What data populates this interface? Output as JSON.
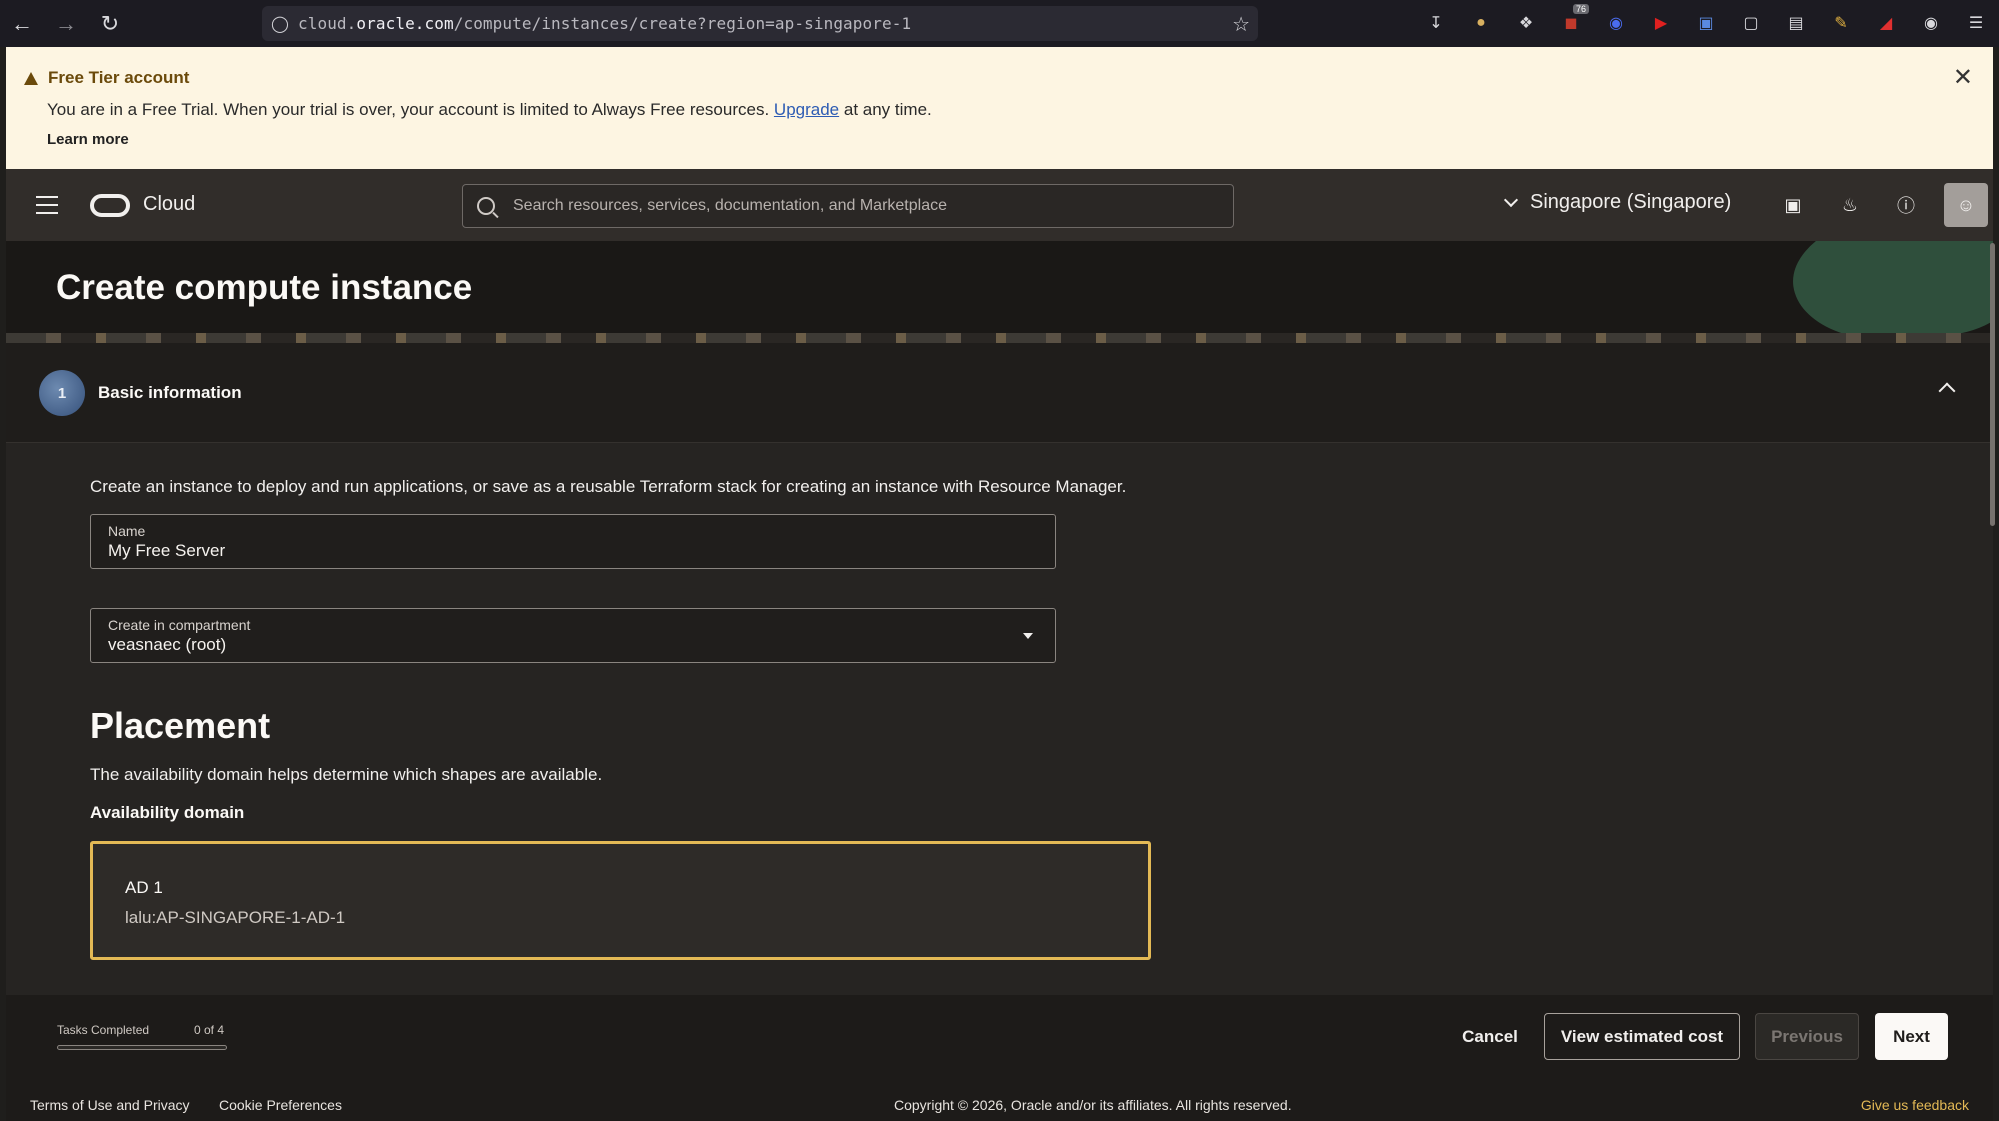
{
  "browser": {
    "url_prefix": "cloud.",
    "url_domain": "oracle.com",
    "url_path": "/compute/instances/create?region=ap-singapore-1",
    "ext_badge": "76"
  },
  "banner": {
    "title": "Free Tier account",
    "text_before": "You are in a Free Trial. When your trial is over, your account is limited to Always Free resources.",
    "link": "Upgrade",
    "text_after": "at any time.",
    "learn_more": "Learn more"
  },
  "header": {
    "brand": "Cloud",
    "search_placeholder": "Search resources, services, documentation, and Marketplace",
    "region": "Singapore (Singapore)"
  },
  "page": {
    "title": "Create compute instance"
  },
  "section": {
    "step": "1",
    "label": "Basic information",
    "description": "Create an instance to deploy and run applications, or save as a reusable Terraform stack for creating an instance with Resource Manager."
  },
  "form": {
    "name_label": "Name",
    "name_value": "My Free Server",
    "compartment_label": "Create in compartment",
    "compartment_value": "veasnaec (root)"
  },
  "placement": {
    "heading": "Placement",
    "description": "The availability domain helps determine which shapes are available.",
    "ad_label": "Availability domain",
    "ad_name": "AD 1",
    "ad_id": "lalu:AP-SINGAPORE-1-AD-1"
  },
  "actions": {
    "tasks_label": "Tasks Completed",
    "tasks_count": "0 of 4",
    "tasks_done_fraction": 0,
    "cancel": "Cancel",
    "view_cost": "View estimated cost",
    "previous": "Previous",
    "next": "Next"
  },
  "footer": {
    "terms": "Terms of Use and Privacy",
    "cookie": "Cookie Preferences",
    "copyright": "Copyright © 2026, Oracle and/or its affiliates. All rights reserved.",
    "feedback": "Give us feedback"
  },
  "colors": {
    "accent": "#e3b955",
    "header_bg": "#312d2a",
    "banner_bg": "#fdf5e2"
  }
}
